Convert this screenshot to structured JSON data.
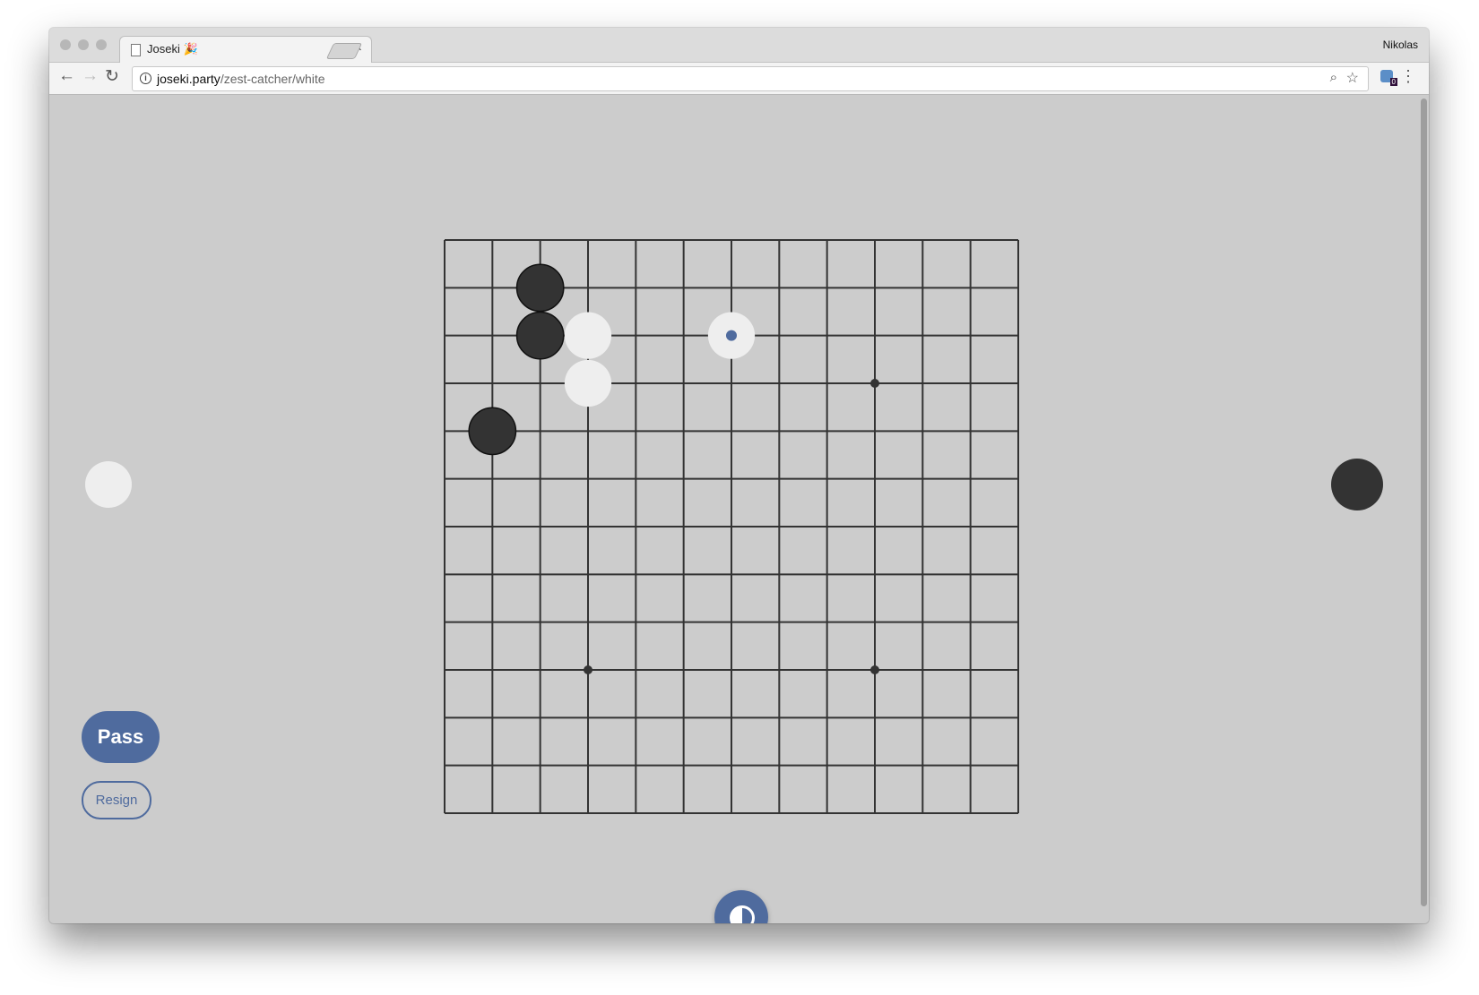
{
  "browser": {
    "tab_title": "Joseki 🎉",
    "tab_close": "×",
    "user_name": "Nikolas",
    "url_host": "joseki.party",
    "url_path": "/zest-catcher/white",
    "extension_badge": "0"
  },
  "game": {
    "board_size": 13,
    "star_points": [
      [
        9,
        3
      ],
      [
        3,
        9
      ],
      [
        9,
        9
      ]
    ],
    "black_stones": [
      [
        2,
        1
      ],
      [
        2,
        2
      ],
      [
        1,
        4
      ]
    ],
    "white_stones": [
      [
        3,
        2
      ],
      [
        3,
        3
      ],
      [
        6,
        2
      ]
    ],
    "last_move": [
      6,
      2
    ],
    "colors": {
      "board_bg": "#cccccc",
      "grid": "#333333",
      "black": "#333333",
      "white": "#eeeeee",
      "accent": "#4f6b9e"
    },
    "player_left_stone": "white",
    "player_right_stone": "black",
    "pass_label": "Pass",
    "resign_label": "Resign",
    "theme_toggle_icon": "contrast-icon"
  }
}
